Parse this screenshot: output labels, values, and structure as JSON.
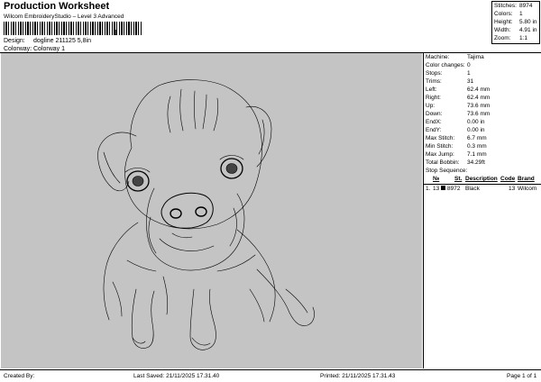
{
  "header": {
    "title": "Production Worksheet",
    "subtitle": "Wilcom EmbroideryStudio – Level 3 Advanced",
    "barcode_mark": "1"
  },
  "design": {
    "label": "Design:",
    "value": "dogline 211125 5,8in"
  },
  "colorway": {
    "label": "Colorway:",
    "value": "Colorway 1"
  },
  "stats": [
    {
      "label": "Stitches:",
      "value": "8974"
    },
    {
      "label": "Colors:",
      "value": "1"
    },
    {
      "label": "Height:",
      "value": "5.80 in"
    },
    {
      "label": "Width:",
      "value": "4.91 in"
    },
    {
      "label": "Zoom:",
      "value": "1:1"
    }
  ],
  "machine_info": [
    {
      "label": "Machine:",
      "value": "Tajima"
    },
    {
      "label": "Color changes:",
      "value": "0"
    },
    {
      "label": "Stops:",
      "value": "1"
    },
    {
      "label": "Trims:",
      "value": "31"
    },
    {
      "label": "Left:",
      "value": "62.4 mm"
    },
    {
      "label": "Right:",
      "value": "62.4 mm"
    },
    {
      "label": "Up:",
      "value": "73.6 mm"
    },
    {
      "label": "Down:",
      "value": "73.6 mm"
    },
    {
      "label": "EndX:",
      "value": "0.00 in"
    },
    {
      "label": "EndY:",
      "value": "0.00 in"
    },
    {
      "label": "Max Stitch:",
      "value": "6.7 mm"
    },
    {
      "label": "Min Stitch:",
      "value": "0.3 mm"
    },
    {
      "label": "Max Jump:",
      "value": "7.1 mm"
    },
    {
      "label": "Total Bobbin:",
      "value": "34.29ft"
    }
  ],
  "stop_sequence": {
    "title": "Stop Sequence:",
    "headers": {
      "no": "№",
      "st": "St.",
      "description": "Description",
      "code": "Code",
      "brand": "Brand"
    },
    "rows": [
      {
        "stop": "1.",
        "no": "13",
        "st": "8972",
        "description": "Black",
        "code": "13",
        "brand": "Wilcom",
        "color": "#000000"
      }
    ]
  },
  "footer": {
    "created_by": "Created By:",
    "last_saved": "Last Saved: 21/11/2025 17.31.40",
    "printed": "Printed: 21/11/2025 17.31.43",
    "page": "Page 1 of 1"
  },
  "colors": {
    "canvas": "#c4c4c4",
    "stitch": "#000000"
  }
}
